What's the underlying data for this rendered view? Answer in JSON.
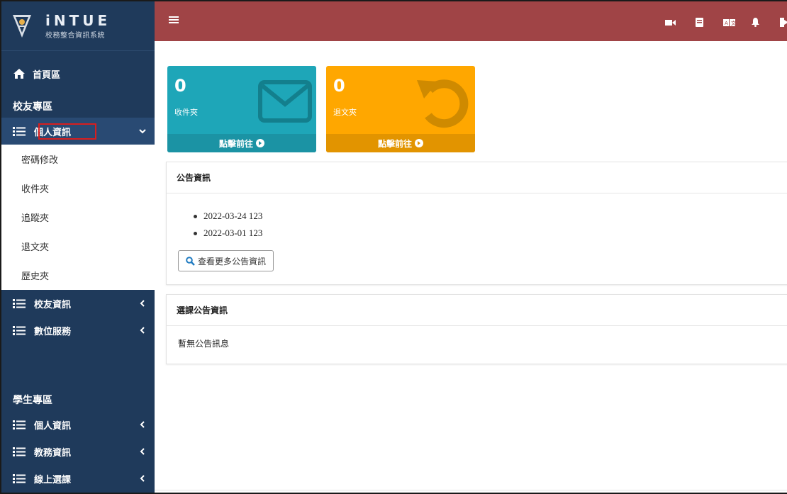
{
  "brand": {
    "name": "iNTUE",
    "subtitle": "校務整合資訊系統"
  },
  "sidebar": {
    "home_label": "首頁區",
    "alumni_section": {
      "title": "校友專區",
      "items": [
        {
          "label": "個人資訊",
          "expanded": true,
          "subitems": [
            "密碼修改",
            "收件夾",
            "追蹤夾",
            "退文夾",
            "歷史夾"
          ]
        },
        {
          "label": "校友資訊",
          "expanded": false
        },
        {
          "label": "數位服務",
          "expanded": false
        }
      ]
    },
    "student_section": {
      "title": "學生專區",
      "items": [
        {
          "label": "個人資訊"
        },
        {
          "label": "教務資訊"
        },
        {
          "label": "線上選課"
        }
      ]
    }
  },
  "topbar": {
    "color": "#a04446",
    "icons": [
      "menu-icon",
      "video-icon",
      "book-icon",
      "translate-icon",
      "bell-icon",
      "logout-icon"
    ]
  },
  "cards": {
    "inbox": {
      "count": "0",
      "label": "收件夾",
      "footer": "點擊前往",
      "color": "#1ea6b8",
      "icon": "envelope-icon"
    },
    "returned": {
      "count": "0",
      "label": "退文夾",
      "footer": "點擊前往",
      "color": "#ffa700",
      "icon": "undo-icon"
    }
  },
  "announcements": {
    "title": "公告資訊",
    "items": [
      "2022-03-24 123",
      "2022-03-01 123"
    ],
    "more_button": "查看更多公告資訊"
  },
  "course_announcements": {
    "title": "選課公告資訊",
    "empty_text": "暫無公告訊息"
  }
}
